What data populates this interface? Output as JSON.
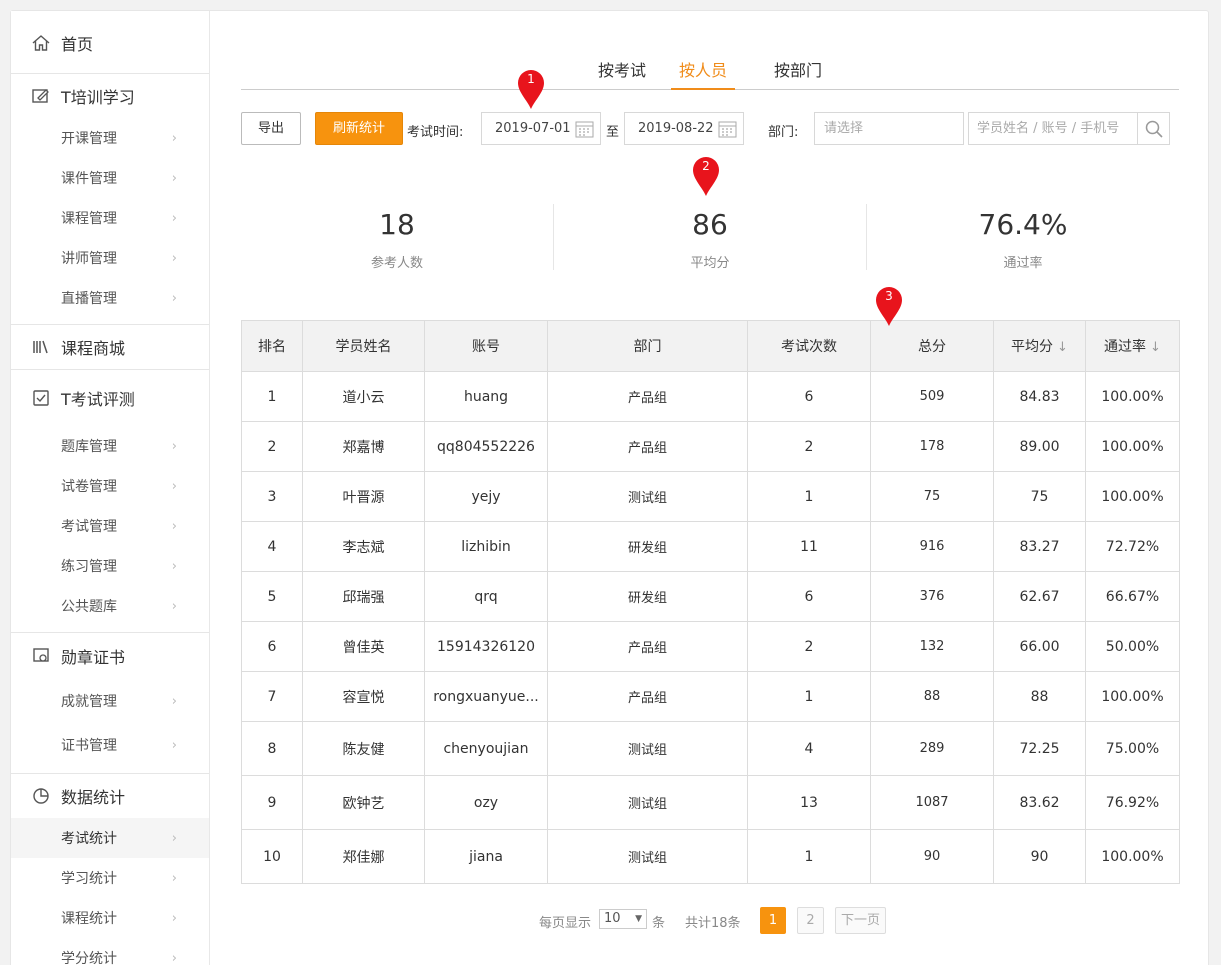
{
  "sidebar": {
    "home": "首页",
    "groups": [
      {
        "title": "T培训学习",
        "items": [
          "开课管理",
          "课件管理",
          "课程管理",
          "讲师管理",
          "直播管理"
        ]
      },
      {
        "title": "课程商城",
        "items": []
      },
      {
        "title": "T考试评测",
        "items": [
          "题库管理",
          "试卷管理",
          "考试管理",
          "练习管理",
          "公共题库"
        ]
      },
      {
        "title": "勋章证书",
        "items": [
          "成就管理",
          "证书管理"
        ]
      },
      {
        "title": "数据统计",
        "items": [
          "考试统计",
          "学习统计",
          "课程统计",
          "学分统计"
        ]
      }
    ],
    "chevron": "›",
    "active_item": "考试统计"
  },
  "tabs": [
    "按考试",
    "按人员",
    "按部门"
  ],
  "active_tab": "按人员",
  "toolbar": {
    "export_label": "导出",
    "refresh_label": "刷新统计",
    "exam_time_label": "考试时间:",
    "start_date": "2019-07-01",
    "to_label": "至",
    "end_date": "2019-08-22",
    "dept_label": "部门:",
    "dept_placeholder": "请选择",
    "search_placeholder": "学员姓名 / 账号 / 手机号"
  },
  "markers": [
    "1",
    "2",
    "3"
  ],
  "stats": {
    "participants": {
      "value": "18",
      "label": "参考人数"
    },
    "avg_score": {
      "value": "86",
      "label": "平均分"
    },
    "pass_rate": {
      "value": "76.4%",
      "label": "通过率"
    }
  },
  "table": {
    "headers": [
      "排名",
      "学员姓名",
      "账号",
      "部门",
      "考试次数",
      "总分",
      "平均分",
      "通过率"
    ],
    "sort_icon": "↓",
    "rows": [
      [
        "1",
        "道小云",
        "huang",
        "产品组",
        "6",
        "509",
        "84.83",
        "100.00%"
      ],
      [
        "2",
        "郑嘉博",
        "qq804552226",
        "产品组",
        "2",
        "178",
        "89.00",
        "100.00%"
      ],
      [
        "3",
        "叶晋源",
        "yejy",
        "测试组",
        "1",
        "75",
        "75",
        "100.00%"
      ],
      [
        "4",
        "李志斌",
        "lizhibin",
        "研发组",
        "11",
        "916",
        "83.27",
        "72.72%"
      ],
      [
        "5",
        "邱瑞强",
        "qrq",
        "研发组",
        "6",
        "376",
        "62.67",
        "66.67%"
      ],
      [
        "6",
        "曾佳英",
        "15914326120",
        "产品组",
        "2",
        "132",
        "66.00",
        "50.00%"
      ],
      [
        "7",
        "容宣悦",
        "rongxuanyue...",
        "产品组",
        "1",
        "88",
        "88",
        "100.00%"
      ],
      [
        "8",
        "陈友健",
        "chenyoujian",
        "测试组",
        "4",
        "289",
        "72.25",
        "75.00%"
      ],
      [
        "9",
        "欧钟艺",
        "ozy",
        "测试组",
        "13",
        "1087",
        "83.62",
        "76.92%"
      ],
      [
        "10",
        "郑佳娜",
        "jiana",
        "测试组",
        "1",
        "90",
        "90",
        "100.00%"
      ]
    ]
  },
  "pager": {
    "per_page_label": "每页显示",
    "per_page_value": "10",
    "per_page_unit": "条",
    "total_label": "共计18条",
    "pages": [
      "1",
      "2"
    ],
    "current_page": "1",
    "next_label": "下一页"
  },
  "colors": {
    "accent": "#f7930e",
    "tab_active": "#f08c1a",
    "marker": "#e8141c"
  }
}
